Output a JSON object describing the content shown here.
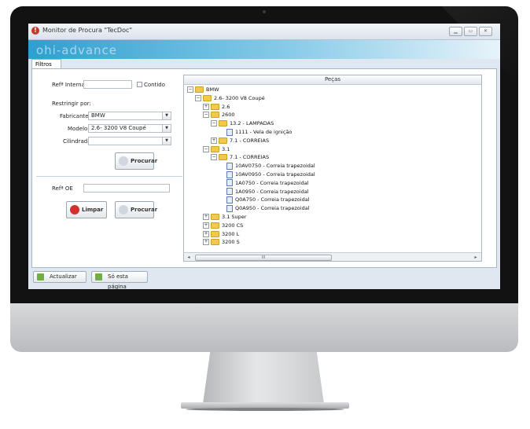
{
  "window": {
    "title": "Monitor de Procura \"TecDoc\"",
    "logo_text": "ohi-advance"
  },
  "tabs": [
    {
      "label": "Filtros"
    }
  ],
  "filters": {
    "ref_interna_label": "Refª Interna",
    "ref_interna_value": "",
    "contido_label": "Contido",
    "restringir_label": "Restringir por:",
    "fabricante_label": "Fabricante",
    "fabricante_value": "BMW",
    "modelo_label": "Modelo",
    "modelo_value": "2.6- 3200 V8 Coupé",
    "cilindrada_label": "Cilindrada",
    "cilindrada_value": "",
    "procurar_label": "Procurar",
    "ref_oe_label": "Refª OE",
    "ref_oe_value": "",
    "limpar_label": "Limpar",
    "procurar2_label": "Procurar"
  },
  "tree": {
    "header": "Peças",
    "nodes": [
      {
        "label": "BMW",
        "type": "folder",
        "exp": "−"
      },
      {
        "label": "2.6- 3200 V8 Coupé",
        "type": "folder",
        "exp": "−"
      },
      {
        "label": "2.6",
        "type": "folder",
        "exp": "+"
      },
      {
        "label": "2600",
        "type": "folder",
        "exp": "−"
      },
      {
        "label": "13.2 - LAMPADAS",
        "type": "folder",
        "exp": "−"
      },
      {
        "label": "1111 - Vela de ignição",
        "type": "doc",
        "exp": ""
      },
      {
        "label": "7.1 - CORREIAS",
        "type": "folder",
        "exp": "+"
      },
      {
        "label": "3.1",
        "type": "folder",
        "exp": "−"
      },
      {
        "label": "7.1 - CORREIAS",
        "type": "folder",
        "exp": "−"
      },
      {
        "label": "10AV0750 - Correia trapezoidal",
        "type": "doc",
        "exp": ""
      },
      {
        "label": "10AV0950 - Correia trapezoidal",
        "type": "doc",
        "exp": ""
      },
      {
        "label": "1A0750 - Correia trapezoidal",
        "type": "doc",
        "exp": ""
      },
      {
        "label": "1A0950 - Correia trapezoidal",
        "type": "doc",
        "exp": ""
      },
      {
        "label": "Q0A750 - Correia trapezoidal",
        "type": "doc",
        "exp": ""
      },
      {
        "label": "Q0A950 - Correia trapezoidal",
        "type": "doc",
        "exp": ""
      },
      {
        "label": "3.1 Super",
        "type": "folder",
        "exp": "+"
      },
      {
        "label": "3200 CS",
        "type": "folder",
        "exp": "+"
      },
      {
        "label": "3200 L",
        "type": "folder",
        "exp": "+"
      },
      {
        "label": "3200 S",
        "type": "folder",
        "exp": "+"
      }
    ],
    "scroll_thumb": "III",
    "scroll_left": "◂",
    "scroll_right": "▸"
  },
  "bottom": {
    "actualizar_label": "Actualizar",
    "so_esta_label": "Só esta página"
  },
  "colors": {
    "banner": "#2e9fd0",
    "accent": "#c0392b"
  }
}
